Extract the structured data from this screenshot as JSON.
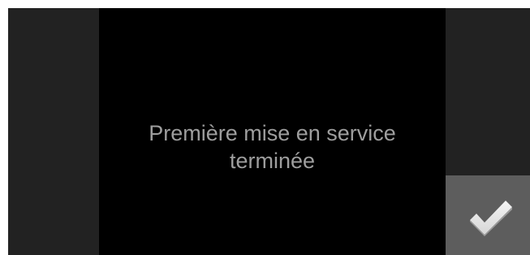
{
  "screen": {
    "message_line1": "Première mise en service",
    "message_line2": "terminée"
  },
  "confirm_button": {
    "icon": "check-icon"
  },
  "colors": {
    "background": "#000000",
    "side_panel": "#222222",
    "confirm_button": "#5d5d5d",
    "text": "#9e9e9e",
    "icon": "#eeeeee"
  }
}
